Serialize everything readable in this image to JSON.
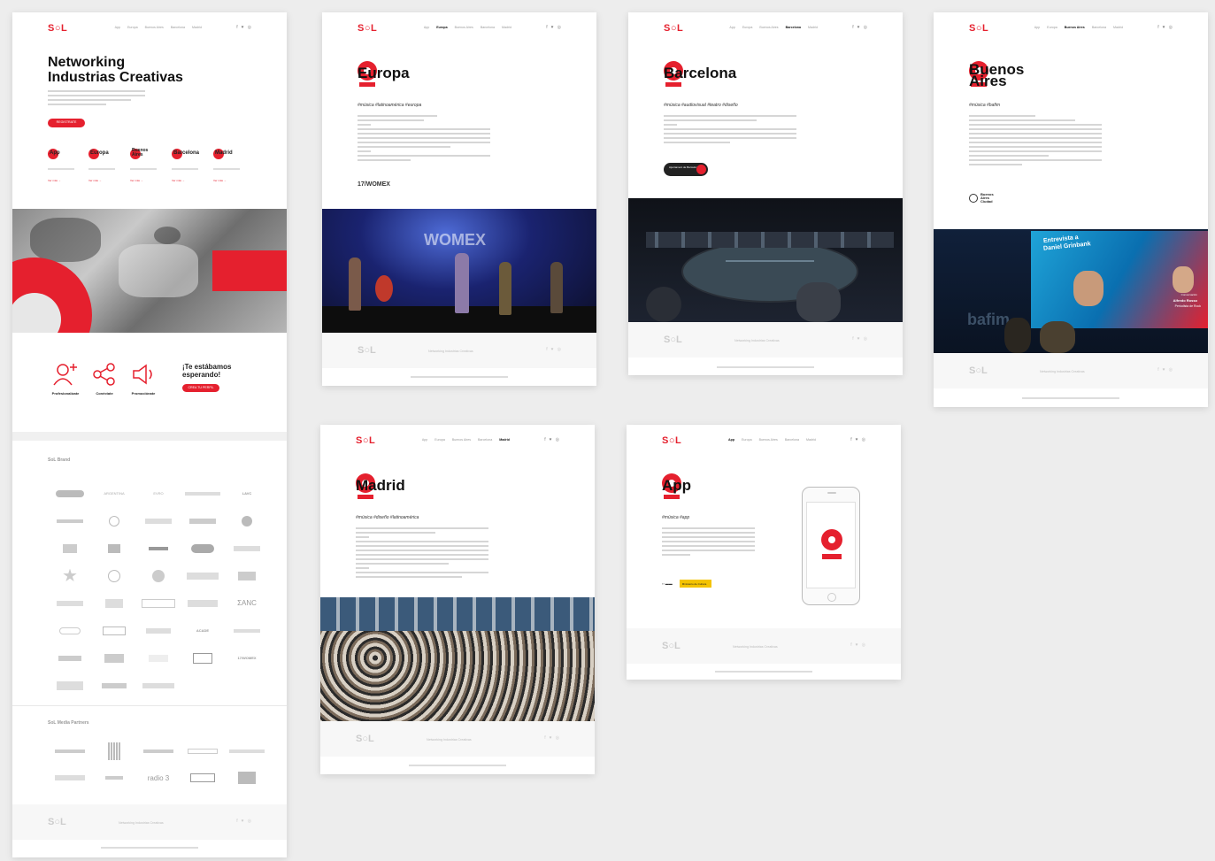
{
  "colors": {
    "accent": "#e5202e",
    "background": "#ededed"
  },
  "brand": {
    "logo": "S○L"
  },
  "nav": {
    "items": [
      "App",
      "Europa",
      "Buenos Aires",
      "Barcelona",
      "Madrid"
    ]
  },
  "social_icons": [
    "f",
    "♥",
    "◎"
  ],
  "home": {
    "heading_line1": "Networking",
    "heading_line2": "Industrias Creativas",
    "register_button": "REGISTRATE",
    "cities": [
      "App",
      "Europa",
      "Buenos Aires",
      "Barcelona",
      "Madrid"
    ],
    "city_link": "Ver más →",
    "icons": [
      {
        "icon": "user-plus-icon",
        "label": "Profesionalízate"
      },
      {
        "icon": "share-icon",
        "label": "Conéctate"
      },
      {
        "icon": "speaker-icon",
        "label": "Promociónate"
      }
    ],
    "cta_line1": "¡Te estábamos",
    "cta_line2": "esperando!",
    "cta_button": "CREA TU PERFIL",
    "sponsors_title": "SoL Brand",
    "media_title": "SoL Media Partners",
    "sponsor_samples": [
      "ARGENTINA",
      "EVRO",
      "WOMEX",
      "LAVC",
      "ACADE",
      "17/WOMEX",
      "radio 3",
      "ICEX"
    ],
    "footer_text": "Networking Industrias Creativas"
  },
  "europa": {
    "title": "Europa",
    "tags": "#música #latinoamérica #europa",
    "sponsor_logo": "17/WOMEX",
    "photo_text": "WOMEX"
  },
  "barcelona": {
    "title": "Barcelona",
    "tags": "#música #audiovisual #teatro #diseño",
    "sponsor_logo": "Ajuntament de Barcelona"
  },
  "buenos_aires": {
    "title_line1": "Buenos",
    "title_line2": "Aires",
    "tags": "#música #bafim",
    "sponsor_logo": "Buenos Aires Ciudad",
    "screen_text_line1": "Entrevista a",
    "screen_text_line2": "Daniel Grinbank",
    "screen_caption1": "Alfredo Rosso",
    "screen_caption2": "Periodista de Rock",
    "screen_sub": "Conversación",
    "photo_text": "bafim"
  },
  "madrid": {
    "title": "Madrid",
    "tags": "#música #diseño #latinoamérica"
  },
  "app": {
    "title": "App",
    "tags": "#música #app",
    "logo_badge": "Ministerio de Cultura"
  }
}
